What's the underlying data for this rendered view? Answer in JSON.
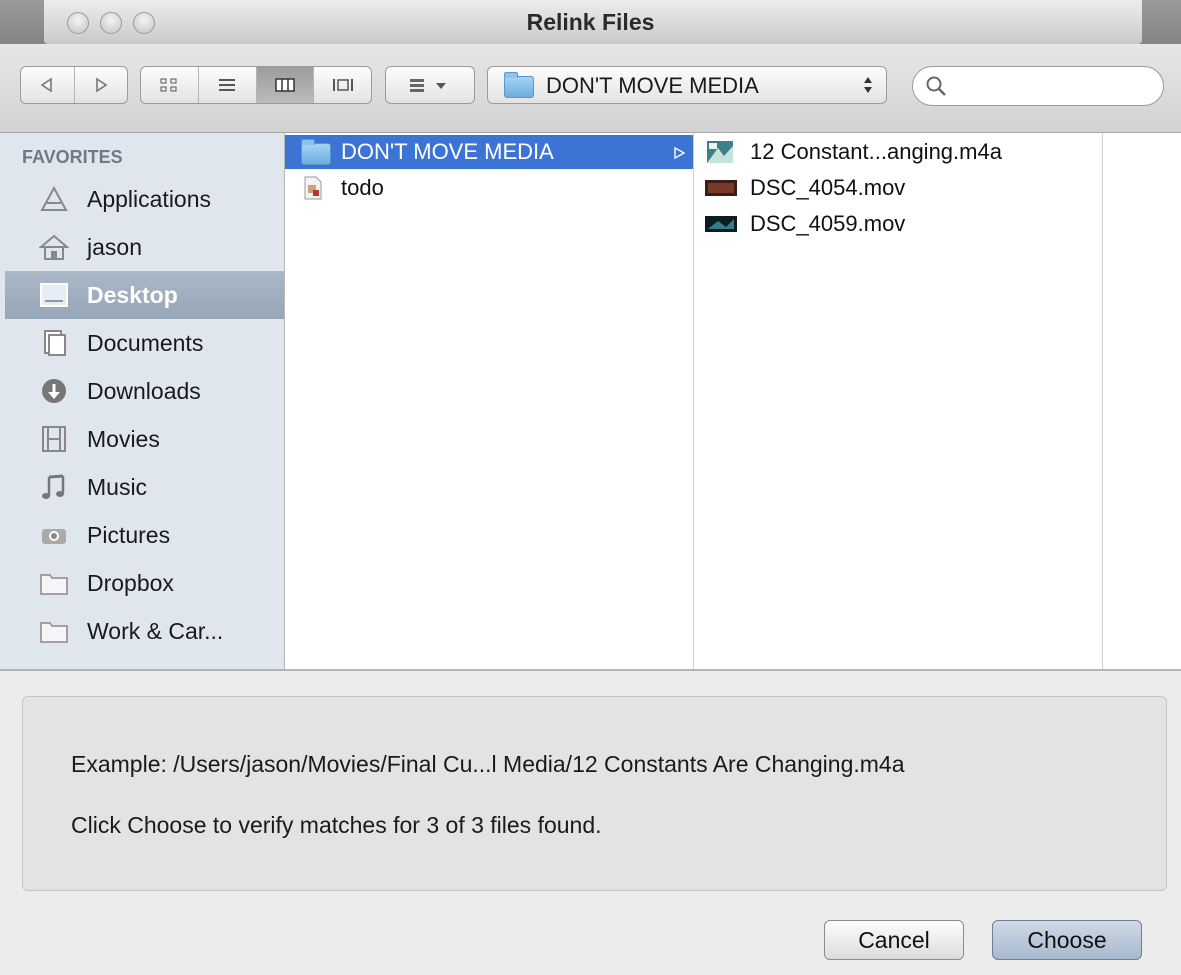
{
  "window": {
    "title": "Relink Files"
  },
  "toolbar": {
    "location": "DON'T MOVE MEDIA",
    "search_placeholder": ""
  },
  "sidebar": {
    "header": "FAVORITES",
    "items": [
      {
        "label": "Applications",
        "icon": "applications-icon"
      },
      {
        "label": "jason",
        "icon": "home-icon"
      },
      {
        "label": "Desktop",
        "icon": "desktop-icon",
        "selected": true
      },
      {
        "label": "Documents",
        "icon": "documents-icon"
      },
      {
        "label": "Downloads",
        "icon": "downloads-icon"
      },
      {
        "label": "Movies",
        "icon": "movies-icon"
      },
      {
        "label": "Music",
        "icon": "music-icon"
      },
      {
        "label": "Pictures",
        "icon": "pictures-icon"
      },
      {
        "label": "Dropbox",
        "icon": "folder-icon"
      },
      {
        "label": "Work & Car...",
        "icon": "folder-icon"
      }
    ]
  },
  "browser": {
    "column1": [
      {
        "label": "DON'T MOVE MEDIA",
        "icon": "folder-icon",
        "selected": true
      },
      {
        "label": "todo",
        "icon": "document-icon"
      }
    ],
    "column2": [
      {
        "label": "12 Constant...anging.m4a",
        "icon": "audio-file-icon"
      },
      {
        "label": "DSC_4054.mov",
        "icon": "movie-file-icon"
      },
      {
        "label": "DSC_4059.mov",
        "icon": "movie-file-icon"
      }
    ]
  },
  "info": {
    "example": "Example: /Users/jason/Movies/Final Cu...l Media/12 Constants Are Changing.m4a",
    "status": "Click Choose to verify matches for 3 of 3 files found."
  },
  "buttons": {
    "cancel": "Cancel",
    "choose": "Choose"
  }
}
